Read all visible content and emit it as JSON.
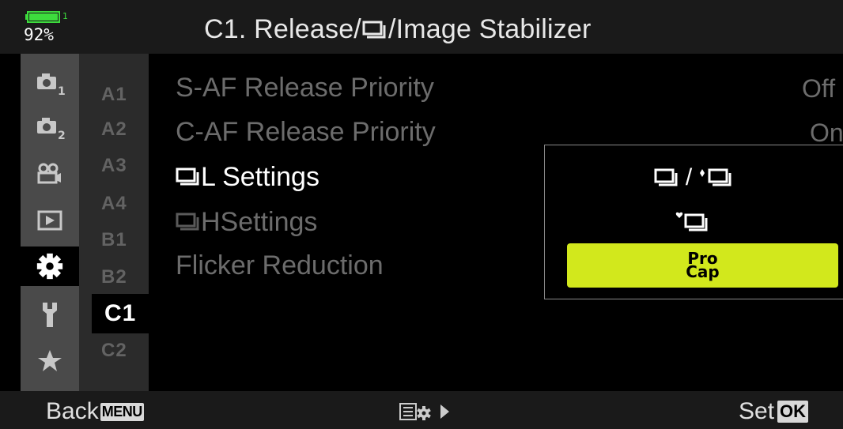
{
  "status": {
    "battery_percent": "92%",
    "battery_level": 0.92,
    "battery_marker": "1"
  },
  "header": {
    "title_prefix": "C1. Release/",
    "title_suffix": "/Image Stabilizer"
  },
  "tabs": [
    {
      "icon": "shooting-menu-1-icon",
      "sub": "1"
    },
    {
      "icon": "shooting-menu-2-icon",
      "sub": "2"
    },
    {
      "icon": "video-menu-icon"
    },
    {
      "icon": "playback-menu-icon"
    },
    {
      "icon": "custom-menu-gear-icon",
      "active": true
    },
    {
      "icon": "setup-menu-wrench-icon"
    },
    {
      "icon": "my-menu-star-icon"
    }
  ],
  "subtabs": [
    "A1",
    "A2",
    "A3",
    "A4",
    "B1",
    "B2",
    "C1",
    "C2"
  ],
  "active_subtab": "C1",
  "menu": {
    "items": [
      {
        "label": "S-AF Release Priority",
        "value": "Off"
      },
      {
        "label": "C-AF Release Priority",
        "value": "On"
      },
      {
        "label": "L Settings",
        "selected": true
      },
      {
        "label": "HSettings"
      },
      {
        "label": "Flicker Reduction"
      }
    ]
  },
  "popup": {
    "options": [
      {
        "label": "/"
      },
      {
        "label": ""
      },
      {
        "label_line1": "Pro",
        "label_line2": "Cap",
        "selected": true
      }
    ],
    "highlight_color": "#d2e81c"
  },
  "footer": {
    "back_label": "Back",
    "menu_key": "MENU",
    "set_label": "Set",
    "ok_key": "OK"
  }
}
